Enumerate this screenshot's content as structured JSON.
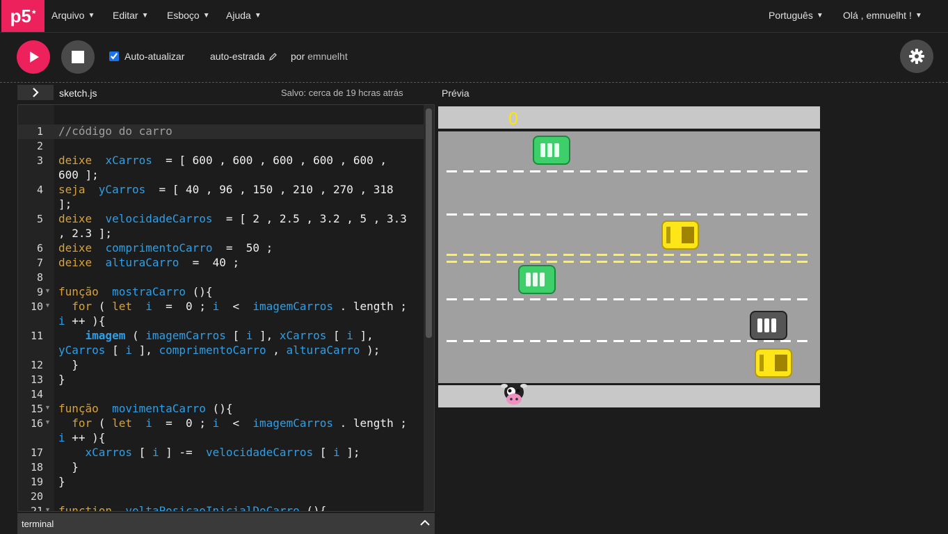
{
  "nav": {
    "logo": "p5",
    "logo_star": "*",
    "menus": [
      "Arquivo",
      "Editar",
      "Esboço",
      "Ajuda"
    ],
    "language": "Português",
    "greeting": "Olá , emnuelht !"
  },
  "toolbar": {
    "auto_refresh_label": "Auto-atualizar",
    "auto_refresh_checked": true,
    "sketch_name": "auto-estrada",
    "by_label": "por",
    "author": "emnuelht"
  },
  "editor": {
    "file_name": "sketch.js",
    "saved_status": "Salvo: cerca de 19 hcras atrás",
    "preview_label": "Prévia",
    "terminal_label": "terminal"
  },
  "code_lines": [
    {
      "n": "1",
      "text": "//código do carro"
    },
    {
      "n": "2",
      "text": ""
    },
    {
      "n": "3",
      "text": "deixe  xCarros  = [ 600 , 600 , 600 , 600 , 600 ,"
    },
    {
      "n": "",
      "text": "600 ];"
    },
    {
      "n": "4",
      "text": "seja  yCarros  = [ 40 , 96 , 150 , 210 , 270 , 318"
    },
    {
      "n": "",
      "text": "];"
    },
    {
      "n": "5",
      "text": "deixe  velocidadeCarros  = [ 2 , 2.5 , 3.2 , 5 , 3.3"
    },
    {
      "n": "",
      "text": ", 2.3 ];"
    },
    {
      "n": "6",
      "text": "deixe  comprimentoCarro  =  50 ;"
    },
    {
      "n": "7",
      "text": "deixe  alturaCarro  =  40 ;"
    },
    {
      "n": "8",
      "text": ""
    },
    {
      "n": "9",
      "text": "função  mostraCarro (){"
    },
    {
      "n": "10",
      "text": "  for ( let  i  =  0 ; i  <  imagemCarros . length ;"
    },
    {
      "n": "",
      "text": "i ++ ){"
    },
    {
      "n": "11",
      "text": "    imagem ( imagemCarros [ i ], xCarros [ i ],"
    },
    {
      "n": "",
      "text": "yCarros [ i ], comprimentoCarro , alturaCarro );"
    },
    {
      "n": "12",
      "text": "  }"
    },
    {
      "n": "13",
      "text": "}"
    },
    {
      "n": "14",
      "text": ""
    },
    {
      "n": "15",
      "text": "função  movimentaCarro (){"
    },
    {
      "n": "16",
      "text": "  for ( let  i  =  0 ; i  <  imagemCarros . length ;"
    },
    {
      "n": "",
      "text": "i ++ ){"
    },
    {
      "n": "17",
      "text": "    xCarros [ i ] -=  velocidadeCarros [ i ];"
    },
    {
      "n": "18",
      "text": "  }"
    },
    {
      "n": "19",
      "text": "}"
    },
    {
      "n": "20",
      "text": ""
    },
    {
      "n": "21",
      "text": "function  voltaPosicaoInicialDoCarro (){"
    }
  ],
  "game": {
    "score": "0",
    "cars": [
      "green",
      "yellow",
      "green",
      "gray",
      "yellow"
    ],
    "colors": {
      "asphalt": "#a0a0a0",
      "sidewalk": "#c8c8c8",
      "score": "#ffe600",
      "lane": "#ffffff",
      "center_lane": "#ffef5a"
    }
  },
  "colors": {
    "accent": "#ed225d",
    "bg": "#1c1c1c"
  }
}
